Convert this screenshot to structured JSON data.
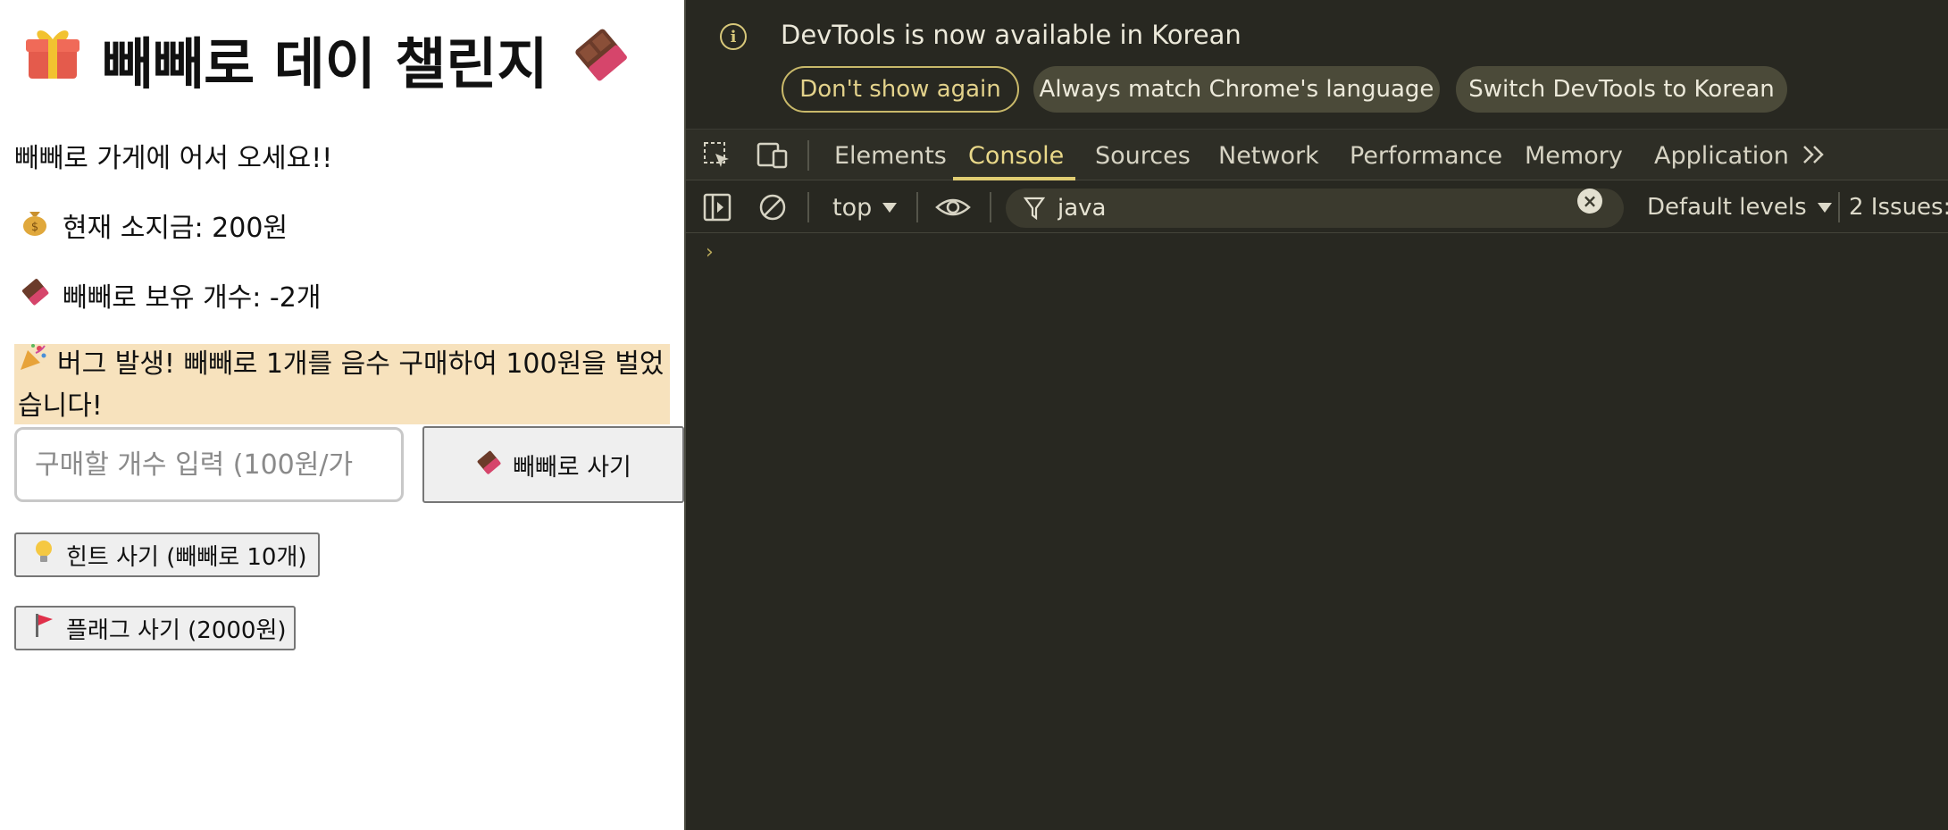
{
  "page": {
    "title": "빼빼로 데이 챌린지",
    "welcome": "빼빼로 가게에 어서 오세요!!",
    "money_text": "현재 소지금: 200원",
    "count_text": "빼빼로 보유 개수: -2개",
    "bug_message": "버그 발생! 빼빼로 1개를 음수 구매하여 100원을 벌었습니다!",
    "quantity_placeholder": "구매할 개수 입력 (100원/가",
    "buy_label": "빼빼로 사기",
    "hint_label": "힌트 사기 (빼빼로 10개)",
    "flag_label": "플래그 사기 (2000원)",
    "icons": [
      "gift-icon",
      "chocolate-icon",
      "money-bag-icon",
      "party-popper-icon",
      "lightbulb-icon",
      "red-flag-icon"
    ]
  },
  "devtools": {
    "notice": "DevTools is now available in Korean",
    "buttons": {
      "dont_show": "Don't show again",
      "match_language": "Always match Chrome's language",
      "switch_language": "Switch DevTools to Korean"
    },
    "tabs": [
      "Elements",
      "Console",
      "Sources",
      "Network",
      "Performance",
      "Memory",
      "Application"
    ],
    "active_tab": "Console",
    "context": "top",
    "filter_value": "java",
    "levels": "Default levels",
    "issues": "2 Issues:",
    "accent_color": "#e0cd72",
    "background_color": "#282821"
  }
}
